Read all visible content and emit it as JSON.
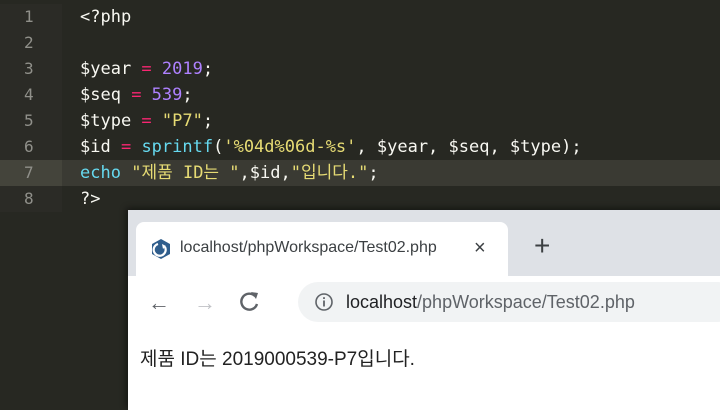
{
  "editor": {
    "lines": [
      {
        "n": "1",
        "segments": [
          {
            "text": "<?php",
            "cls": "t-kw"
          }
        ]
      },
      {
        "n": "2",
        "segments": []
      },
      {
        "n": "3",
        "segments": [
          {
            "text": "$year",
            "cls": "t-kw"
          },
          {
            "text": " = ",
            "cls": "t-op"
          },
          {
            "text": "2019",
            "cls": "t-num"
          },
          {
            "text": ";",
            "cls": "t-kw"
          }
        ]
      },
      {
        "n": "4",
        "segments": [
          {
            "text": "$seq",
            "cls": "t-kw"
          },
          {
            "text": " = ",
            "cls": "t-op"
          },
          {
            "text": "539",
            "cls": "t-num"
          },
          {
            "text": ";",
            "cls": "t-kw"
          }
        ]
      },
      {
        "n": "5",
        "segments": [
          {
            "text": "$type",
            "cls": "t-kw"
          },
          {
            "text": " = ",
            "cls": "t-op"
          },
          {
            "text": "\"P7\"",
            "cls": "t-str"
          },
          {
            "text": ";",
            "cls": "t-kw"
          }
        ]
      },
      {
        "n": "6",
        "segments": [
          {
            "text": "$id",
            "cls": "t-kw"
          },
          {
            "text": " = ",
            "cls": "t-op"
          },
          {
            "text": "sprintf",
            "cls": "t-fn"
          },
          {
            "text": "(",
            "cls": "t-kw"
          },
          {
            "text": "'%04d%06d-%s'",
            "cls": "t-str"
          },
          {
            "text": ", $year, $seq, $type);",
            "cls": "t-kw"
          }
        ]
      },
      {
        "n": "7",
        "active": true,
        "segments": [
          {
            "text": "echo",
            "cls": "t-fn"
          },
          {
            "text": " ",
            "cls": "t-kw"
          },
          {
            "text": "\"제품 ID는 \"",
            "cls": "t-str"
          },
          {
            "text": ",$id,",
            "cls": "t-kw"
          },
          {
            "text": "\"입니다.\"",
            "cls": "t-str"
          },
          {
            "text": ";",
            "cls": "t-kw"
          }
        ]
      },
      {
        "n": "8",
        "segments": [
          {
            "text": "?>",
            "cls": "t-kw"
          }
        ]
      }
    ]
  },
  "browser": {
    "tab_title": "localhost/phpWorkspace/Test02.php",
    "tab_close": "×",
    "new_tab": "+",
    "back": "←",
    "forward": "→",
    "reload": "C",
    "url_host": "localhost",
    "url_path": "/phpWorkspace/Test02.php",
    "page_text": "제품 ID는 2019000539-P7입니다."
  },
  "colors": {
    "editor_bg": "#272822",
    "string": "#e6db74",
    "number": "#ae81ff",
    "operator": "#f92672",
    "function": "#66d9ef"
  }
}
